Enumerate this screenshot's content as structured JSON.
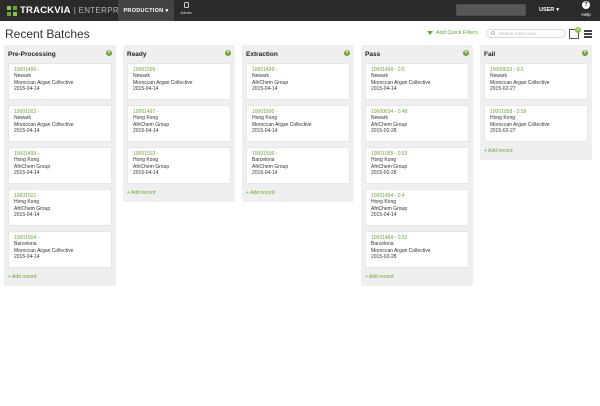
{
  "header": {
    "logo_brand": "TRACKVIA",
    "logo_edition": "ENTERPRISE",
    "app_tab": "PRODUCTION",
    "admin_label": "Admin",
    "user_label": "USER",
    "help_label": "Help"
  },
  "page": {
    "title": "Recent Batches",
    "quick_filters_label": "Add Quick Filters",
    "search_placeholder": "Search within view"
  },
  "columns": [
    {
      "title": "Pre-Processing",
      "add_record": "+ Add record",
      "cards": [
        {
          "id": "10001496 -",
          "location": "Newark",
          "company": "Moroccan Argan Collective",
          "date": "2015-04-14"
        },
        {
          "id": "10001503 -",
          "location": "Newark",
          "company": "Moroccan Argan Collective",
          "date": "2015-04-14"
        },
        {
          "id": "10001499 -",
          "location": "Hong Kong",
          "company": "AfriChem Group",
          "date": "2015-04-14"
        },
        {
          "id": "10001501 -",
          "location": "Hong Kong",
          "company": "AfriChem Group",
          "date": "2015-04-14"
        },
        {
          "id": "10001504 -",
          "location": "Barcelona",
          "company": "Moroccan Argan Collective",
          "date": "2015-04-14"
        }
      ]
    },
    {
      "title": "Ready",
      "add_record": "+ Add record",
      "cards": [
        {
          "id": "10001505 -",
          "location": "Newark",
          "company": "Moroccan Argan Collective",
          "date": "2015-04-14"
        },
        {
          "id": "10001497 -",
          "location": "Hong Kong",
          "company": "AfriChem Group",
          "date": "2015-04-14"
        },
        {
          "id": "10001502 -",
          "location": "Hong Kong",
          "company": "AfriChem Group",
          "date": "2015-04-14"
        }
      ]
    },
    {
      "title": "Extraction",
      "add_record": "+ Add record",
      "cards": [
        {
          "id": "10001499 -",
          "location": "Newark",
          "company": "AfriChem Group",
          "date": "2015-04-14"
        },
        {
          "id": "10001500 -",
          "location": "Hong Kong",
          "company": "Moroccan Argan Collective",
          "date": "2015-04-14"
        },
        {
          "id": "10001506 -",
          "location": "Barcelona",
          "company": "AfriChem Group",
          "date": "2015-04-14"
        }
      ]
    },
    {
      "title": "Pass",
      "add_record": "+ Add record",
      "cards": [
        {
          "id": "10001498 - 0.5",
          "location": "Newark",
          "company": "Moroccan Argan Collective",
          "date": "2015-04-14"
        },
        {
          "id": "10000634 - 0.48",
          "location": "Newark",
          "company": "AfriChem Group",
          "date": "2015-02-28"
        },
        {
          "id": "10001055 - 0.53",
          "location": "Hong Kong",
          "company": "AfriChem Group",
          "date": "2015-02-28"
        },
        {
          "id": "10001494 - 0.4",
          "location": "Hong Kong",
          "company": "AfriChem Group",
          "date": "2015-04-14"
        },
        {
          "id": "10001484 - 0.52",
          "location": "Barcelona",
          "company": "Moroccan Argan Collective",
          "date": "2015-02-28"
        }
      ]
    },
    {
      "title": "Fail",
      "add_record": "+ Add record",
      "cards": [
        {
          "id": "10000633 - 0.5",
          "location": "Newark",
          "company": "Moroccan Argan Collective",
          "date": "2015-02-27"
        },
        {
          "id": "10001058 - 0.59",
          "location": "Hong Kong",
          "company": "Moroccan Argan Collective",
          "date": "2015-02-27"
        }
      ]
    }
  ],
  "colors": {
    "accent": "#6aa72f",
    "topbar": "#2b2b2b",
    "column_bg": "#efefef"
  },
  "icons": {
    "logo": "trackvia-logo-icon",
    "admin": "database-icon",
    "help": "question-icon",
    "filter": "funnel-icon",
    "search": "search-icon",
    "new_view": "new-view-icon",
    "menu": "hamburger-icon",
    "add": "plus-circle-icon"
  }
}
